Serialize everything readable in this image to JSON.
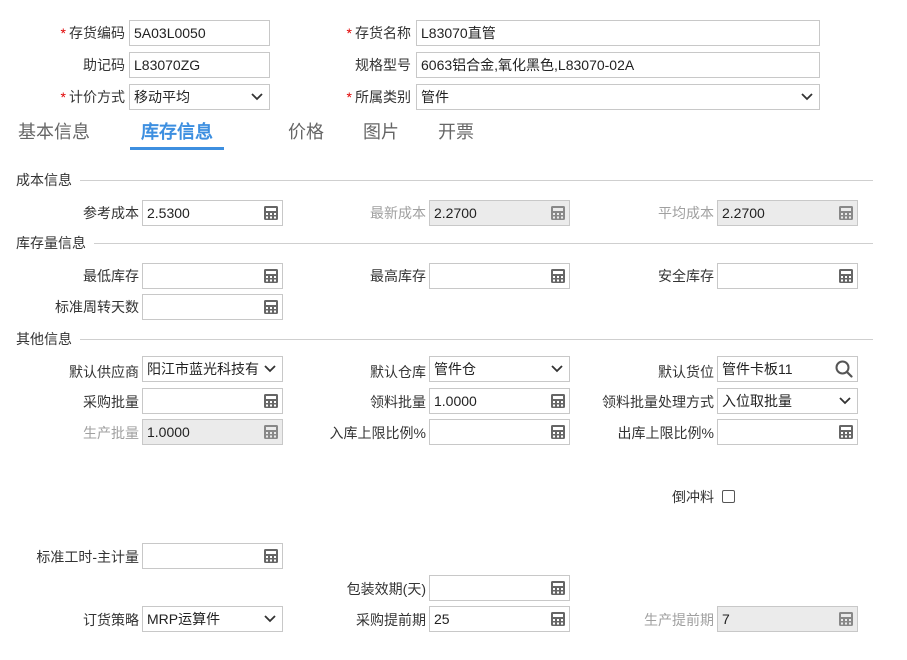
{
  "top_fields": {
    "code_label": "存货编码",
    "code_value": "5A03L0050",
    "name_label": "存货名称",
    "name_value": "L83070直管",
    "mnemonic_label": "助记码",
    "mnemonic_value": "L83070ZG",
    "spec_label": "规格型号",
    "spec_value": "6063铝合金,氧化黑色,L83070-02A",
    "pricing_label": "计价方式",
    "pricing_value": "移动平均",
    "category_label": "所属类别",
    "category_value": "管件",
    "required_mark": "*"
  },
  "tabs": [
    {
      "label": "基本信息",
      "active": false
    },
    {
      "label": "库存信息",
      "active": true
    },
    {
      "label": "价格",
      "active": false
    },
    {
      "label": "图片",
      "active": false
    },
    {
      "label": "开票",
      "active": false
    }
  ],
  "sections": {
    "cost": "成本信息",
    "stock": "库存量信息",
    "other": "其他信息"
  },
  "cost": {
    "ref_label": "参考成本",
    "ref_value": "2.5300",
    "latest_label": "最新成本",
    "latest_value": "2.2700",
    "avg_label": "平均成本",
    "avg_value": "2.2700"
  },
  "stock": {
    "min_label": "最低库存",
    "min_value": "",
    "max_label": "最高库存",
    "max_value": "",
    "safe_label": "安全库存",
    "safe_value": "",
    "turnover_label": "标准周转天数",
    "turnover_value": ""
  },
  "other": {
    "supplier_label": "默认供应商",
    "supplier_value": "阳江市蓝光科技有",
    "warehouse_label": "默认仓库",
    "warehouse_value": "管件仓",
    "location_label": "默认货位",
    "location_value": "管件卡板11",
    "purchase_batch_label": "采购批量",
    "purchase_batch_value": "",
    "issue_batch_label": "领料批量",
    "issue_batch_value": "1.0000",
    "issue_mode_label": "领料批量处理方式",
    "issue_mode_value": "入位取批量",
    "prod_batch_label": "生产批量",
    "prod_batch_value": "1.0000",
    "in_limit_label": "入库上限比例%",
    "in_limit_value": "",
    "out_limit_label": "出库上限比例%",
    "out_limit_value": "",
    "backflush_label": "倒冲料",
    "backflush_checked": false,
    "std_hours_label": "标准工时-主计量",
    "std_hours_value": "",
    "shelf_life_label": "包装效期(天)",
    "shelf_life_value": "",
    "order_policy_label": "订货策略",
    "order_policy_value": "MRP运算件",
    "purchase_lead_label": "采购提前期",
    "purchase_lead_value": "25",
    "prod_lead_label": "生产提前期",
    "prod_lead_value": "7"
  },
  "icons": [
    "calculator-icon",
    "chevron-down-icon",
    "search-icon"
  ],
  "colors": {
    "accent": "#3d8fe0",
    "required": "#e00000",
    "disabled_bg": "#ebebeb"
  }
}
